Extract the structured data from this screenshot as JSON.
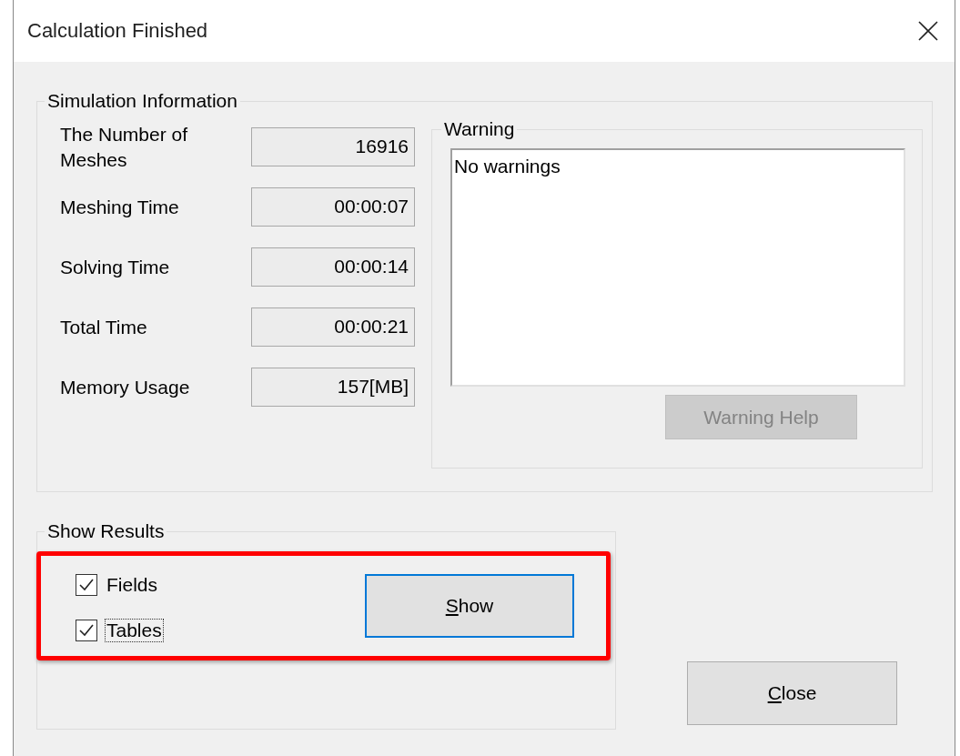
{
  "window": {
    "title": "Calculation Finished"
  },
  "simulation_information": {
    "title": "Simulation Information",
    "fields": [
      {
        "label": "The Number of Meshes",
        "value": "16916"
      },
      {
        "label": "Meshing Time",
        "value": "00:00:07"
      },
      {
        "label": "Solving Time",
        "value": "00:00:14"
      },
      {
        "label": "Total Time",
        "value": "00:00:21"
      },
      {
        "label": "Memory Usage",
        "value": "157[MB]"
      }
    ]
  },
  "warning": {
    "title": "Warning",
    "text": "No warnings",
    "help_button": {
      "label": "Warning Help",
      "disabled": true
    }
  },
  "show_results": {
    "title": "Show Results",
    "highlighted": true,
    "options": [
      {
        "label": "Fields",
        "checked": true,
        "focused": false
      },
      {
        "label": "Tables",
        "checked": true,
        "focused": true
      }
    ],
    "show_button": {
      "label": "Show",
      "underline_first": true,
      "focused": true
    }
  },
  "close_button": {
    "label": "Close",
    "underline_first": true,
    "focused": false
  }
}
